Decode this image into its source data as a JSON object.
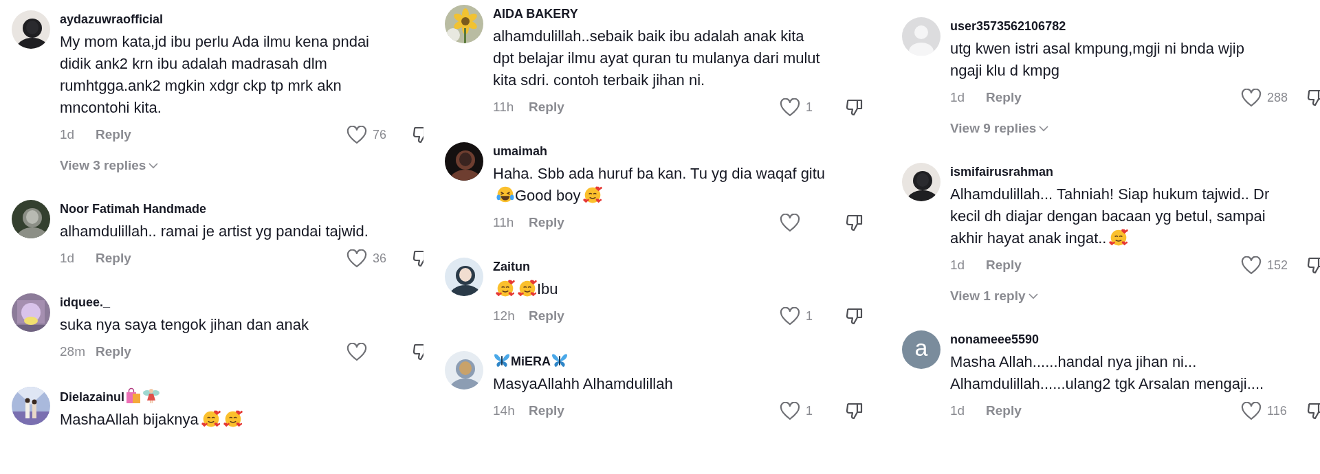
{
  "panels": [
    {
      "comments": [
        {
          "avatar": {
            "kind": "picture"
          },
          "name": [
            {
              "kind": "text",
              "text": "aydazuwraofficial"
            }
          ],
          "body": [
            {
              "kind": "text",
              "text": "My mom kata,jd ibu perlu Ada ilmu kena pndai\ndidik ank2 krn ibu adalah madrasah dlm\nrumhtgga.ank2 mgkin xdgr ckp tp mrk akn\nmncontohi kita."
            }
          ],
          "time": "1d",
          "reply": "Reply",
          "likes": "76",
          "view_replies": "View 3 replies"
        },
        {
          "avatar": {
            "kind": "picture"
          },
          "name": [
            {
              "kind": "text",
              "text": "Noor Fatimah Handmade"
            }
          ],
          "body": [
            {
              "kind": "text",
              "text": "alhamdulillah.. ramai je artist yg pandai tajwid."
            }
          ],
          "time": "1d",
          "reply": "Reply",
          "likes": "36"
        },
        {
          "avatar": {
            "kind": "picture"
          },
          "name": [
            {
              "kind": "text",
              "text": "idquee._"
            }
          ],
          "body": [
            {
              "kind": "text",
              "text": "suka nya saya tengok jihan dan anak"
            }
          ],
          "time": "28m",
          "reply": "Reply"
        },
        {
          "avatar": {
            "kind": "picture"
          },
          "name": [
            {
              "kind": "text",
              "text": "Dielazainul"
            },
            {
              "kind": "shopping-bag"
            },
            {
              "kind": "fairy"
            }
          ],
          "body": [
            {
              "kind": "text",
              "text": "MashaAllah bijaknya"
            },
            {
              "kind": "hearts-face"
            },
            {
              "kind": "hearts-face"
            }
          ]
        }
      ]
    },
    {
      "comments": [
        {
          "avatar": {
            "kind": "picture"
          },
          "name": [
            {
              "kind": "text",
              "text": "AIDA BAKERY"
            }
          ],
          "body": [
            {
              "kind": "text",
              "text": "alhamdulillah..sebaik baik ibu adalah anak kita\ndpt belajar ilmu ayat quran tu mulanya dari mulut\nkita sdri. contoh terbaik jihan ni."
            }
          ],
          "time": "11h",
          "reply": "Reply",
          "likes": "1"
        },
        {
          "avatar": {
            "kind": "picture"
          },
          "name": [
            {
              "kind": "text",
              "text": "umaimah"
            }
          ],
          "body": [
            {
              "kind": "text",
              "text": "Haha. Sbb ada huruf ba kan. Tu yg dia waqaf gitu"
            },
            {
              "kind": "break"
            },
            {
              "kind": "laughing-face"
            },
            {
              "kind": "text",
              "text": "Good boy"
            },
            {
              "kind": "hearts-face"
            }
          ],
          "time": "11h",
          "reply": "Reply"
        },
        {
          "avatar": {
            "kind": "picture"
          },
          "name": [
            {
              "kind": "text",
              "text": "Zaitun"
            }
          ],
          "body": [
            {
              "kind": "hearts-face"
            },
            {
              "kind": "hearts-face"
            },
            {
              "kind": "text",
              "text": "Ibu"
            }
          ],
          "time": "12h",
          "reply": "Reply",
          "likes": "1"
        },
        {
          "avatar": {
            "kind": "picture"
          },
          "name": [
            {
              "kind": "butterfly"
            },
            {
              "kind": "text",
              "text": "MiERA"
            },
            {
              "kind": "butterfly"
            }
          ],
          "body": [
            {
              "kind": "text",
              "text": "MasyaAllahh Alhamdulillah"
            }
          ],
          "time": "14h",
          "reply": "Reply",
          "likes": "1"
        }
      ]
    },
    {
      "comments": [
        {
          "avatar": {
            "kind": "default"
          },
          "name": [
            {
              "kind": "text",
              "text": "user3573562106782"
            }
          ],
          "body": [
            {
              "kind": "text",
              "text": "utg kwen istri asal kmpung,mgji ni bnda wjip\nngaji klu d kmpg"
            }
          ],
          "time": "1d",
          "reply": "Reply",
          "likes": "288",
          "view_replies": "View 9 replies"
        },
        {
          "avatar": {
            "kind": "picture"
          },
          "name": [
            {
              "kind": "text",
              "text": "ismifairusrahman"
            }
          ],
          "body": [
            {
              "kind": "text",
              "text": "Alhamdulillah... Tahniah! Siap hukum tajwid.. Dr\nkecil dh diajar dengan bacaan yg betul, sampai"
            },
            {
              "kind": "break"
            },
            {
              "kind": "text",
              "text": "akhir hayat anak ingat.."
            },
            {
              "kind": "hearts-face"
            }
          ],
          "time": "1d",
          "reply": "Reply",
          "likes": "152",
          "view_replies": "View 1 reply"
        },
        {
          "avatar": {
            "kind": "letter",
            "letter": "a"
          },
          "name": [
            {
              "kind": "text",
              "text": "nonameee5590"
            }
          ],
          "body": [
            {
              "kind": "text",
              "text": "Masha Allah......handal nya jihan ni...\nAlhamdulillah......ulang2 tgk Arsalan mengaji...."
            }
          ],
          "time": "1d",
          "reply": "Reply",
          "likes": "116"
        }
      ]
    }
  ]
}
